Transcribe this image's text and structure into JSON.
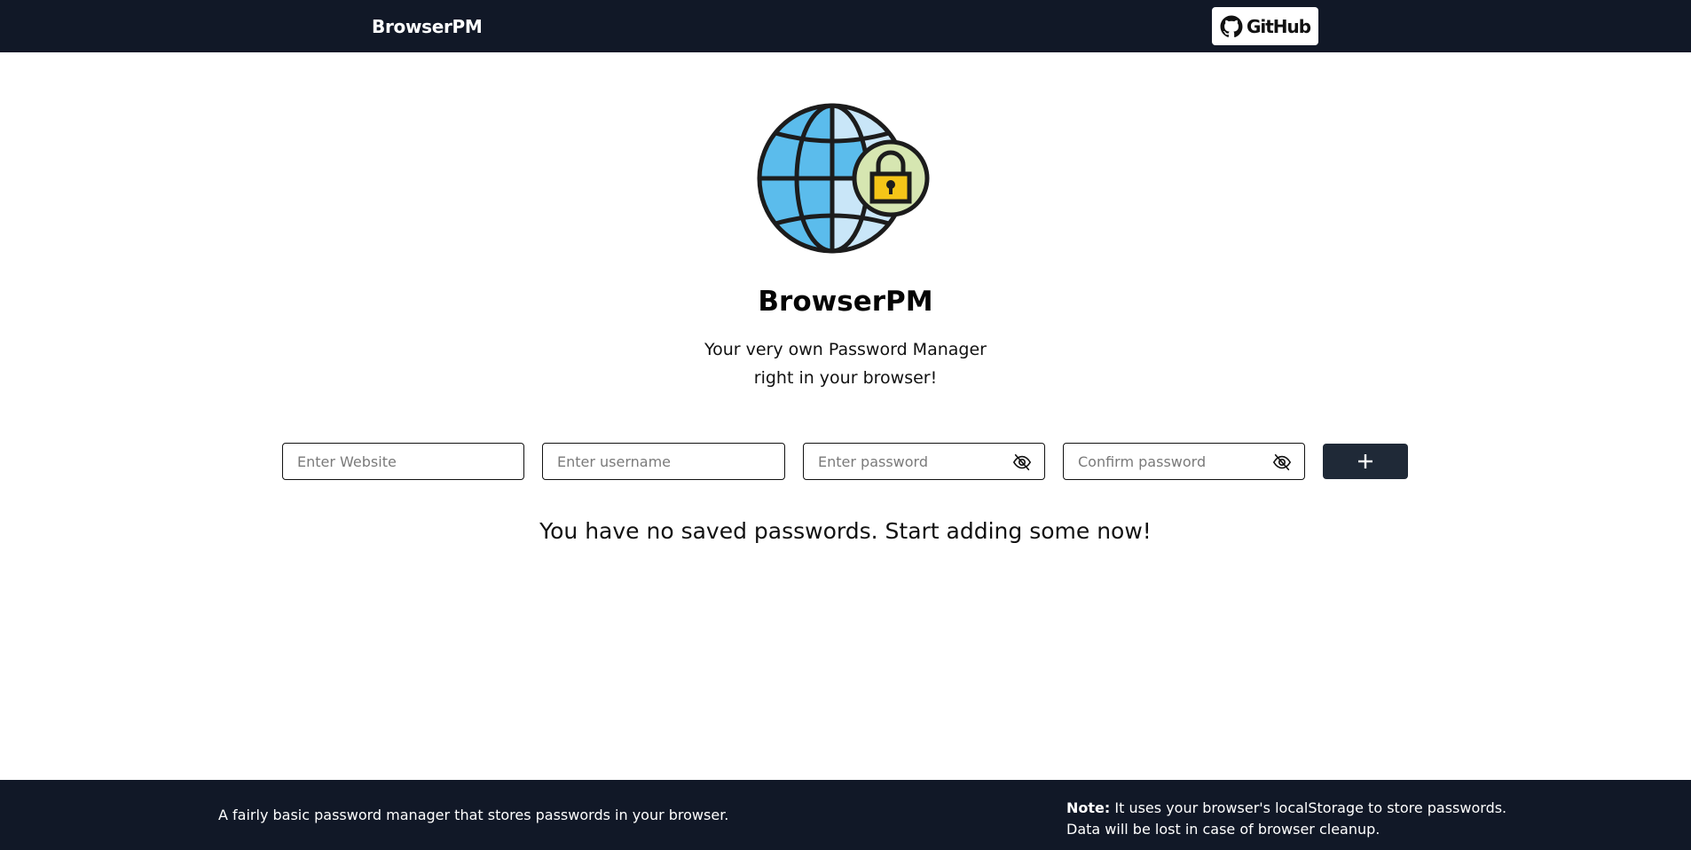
{
  "header": {
    "brand": "BrowserPM",
    "github_label": "GitHub"
  },
  "hero": {
    "logo_icon": "globe-with-padlock-icon",
    "title": "BrowserPM",
    "subtitle_line1": "Your very own Password Manager",
    "subtitle_line2": "right in your browser!"
  },
  "form": {
    "website_placeholder": "Enter Website",
    "username_placeholder": "Enter username",
    "password_placeholder": "Enter password",
    "confirm_placeholder": "Confirm password",
    "add_button_icon": "plus-icon",
    "visibility_icon": "eye-slash-icon"
  },
  "empty_state": "You have no saved passwords. Start adding some now!",
  "footer": {
    "description": "A fairly basic password manager that stores passwords in your browser.",
    "note_label": "Note:",
    "note_text": " It uses your browser's localStorage to store passwords.",
    "note_line2": "Data will be lost in case of browser cleanup."
  },
  "colors": {
    "header_bg": "#111827",
    "button_bg": "#1f2937",
    "globe_blue": "#5bbcec",
    "lock_yellow": "#f5c518"
  }
}
